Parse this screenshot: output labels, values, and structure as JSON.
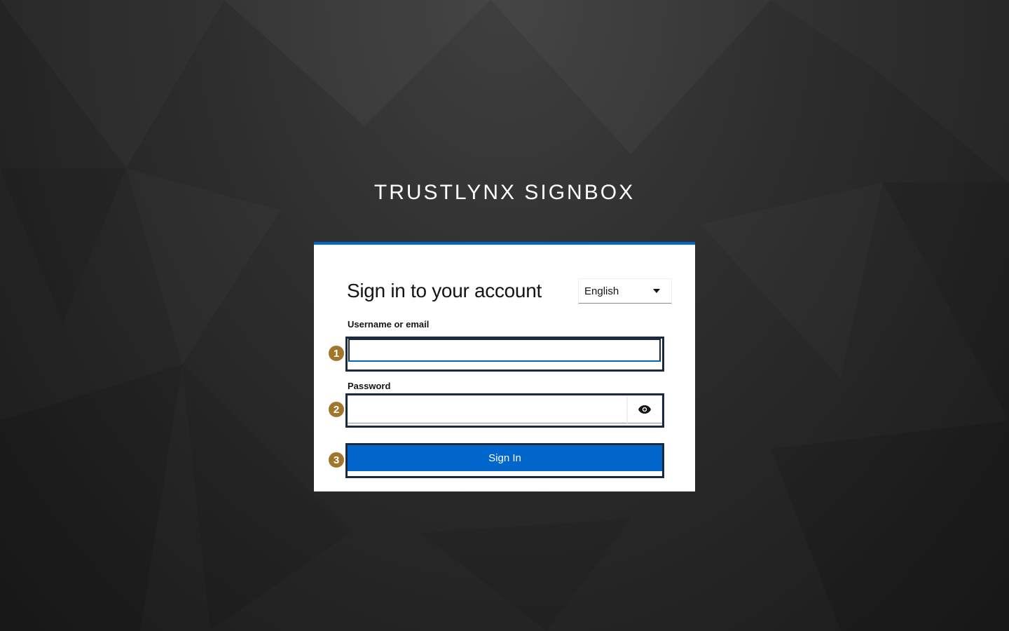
{
  "brand": {
    "title": "TRUSTLYNX SIGNBOX"
  },
  "login": {
    "heading": "Sign in to your account",
    "language": {
      "selected": "English"
    },
    "username": {
      "label": "Username or email",
      "value": "",
      "placeholder": ""
    },
    "password": {
      "label": "Password",
      "value": "",
      "placeholder": "",
      "toggle_icon": "eye-icon"
    },
    "submit_label": "Sign In"
  },
  "annotations": {
    "markers": [
      "1",
      "2",
      "3"
    ]
  },
  "colors": {
    "accent": "#0066cc",
    "marker": "#a0762a",
    "highlight_border": "#1b2a3f",
    "background_dark": "#1a1a1a"
  }
}
